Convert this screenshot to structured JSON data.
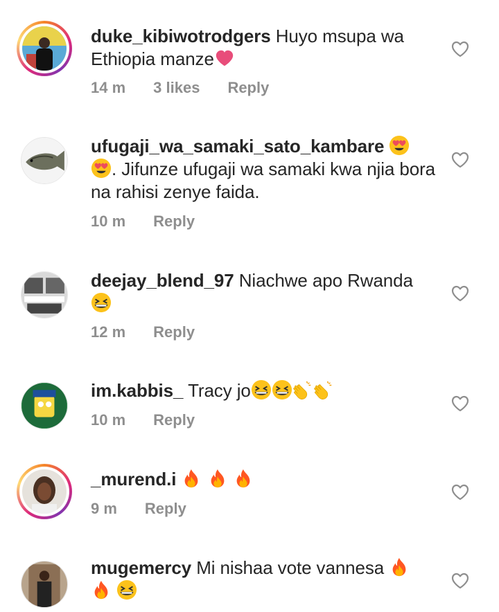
{
  "colors": {
    "username": "#262626",
    "meta": "#8e8e8e",
    "heart_outline": "#8e8e8e"
  },
  "comments": [
    {
      "username": "duke_kibiwotrodgers",
      "text": "Huyo msupa wa Ethiopia manze",
      "emojis": [
        "pink-heart"
      ],
      "time": "14 m",
      "likes": "3 likes",
      "reply": "Reply"
    },
    {
      "username": "ufugaji_wa_samaki_sato_kambare",
      "text_before": "",
      "text": ". Jifunze ufugaji wa samaki kwa njia bora na rahisi zenye faida.",
      "emojis": [
        "heart-eyes",
        "heart-eyes"
      ],
      "time": "10 m",
      "reply": "Reply"
    },
    {
      "username": "deejay_blend_97",
      "text": "Niachwe apo Rwanda",
      "emojis": [
        "grinning-squint"
      ],
      "time": "12 m",
      "reply": "Reply"
    },
    {
      "username": "im.kabbis_",
      "text": "Tracy jo",
      "emojis": [
        "grinning-squint",
        "grinning-squint",
        "clapping",
        "clapping"
      ],
      "time": "10 m",
      "reply": "Reply"
    },
    {
      "username": "_murend.i",
      "text": "",
      "emojis": [
        "fire",
        "fire",
        "fire"
      ],
      "time": "9 m",
      "reply": "Reply"
    },
    {
      "username": "mugemercy",
      "text": "Mi nishaa vote vannesa",
      "emojis": [
        "fire",
        "fire",
        "grinning-squint"
      ],
      "time": "",
      "reply": ""
    }
  ]
}
